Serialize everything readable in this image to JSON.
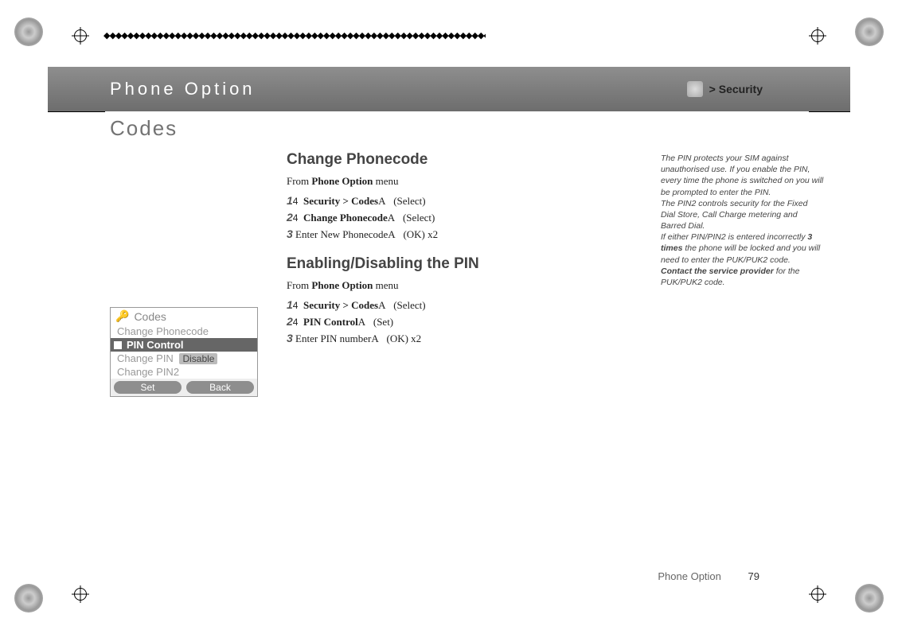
{
  "header": {
    "title": "Phone Option",
    "breadcrumb": "> Security"
  },
  "page_title": "Codes",
  "sections": [
    {
      "heading": "Change Phonecode",
      "from_prefix": "From ",
      "from_bold": "Phone Option",
      "from_suffix": " menu",
      "steps": [
        {
          "num": "1",
          "arrow": "4",
          "bold": "Security > Codes",
          "tail": "A",
          "suffix": "(Select)"
        },
        {
          "num": "2",
          "arrow": "4",
          "bold": "Change Phonecode",
          "tail": "A",
          "suffix": "(Select)"
        },
        {
          "num": "3",
          "arrow": "",
          "plain": "Enter New Phonecode",
          "tail": "A",
          "suffix": "(OK) x2"
        }
      ]
    },
    {
      "heading": "Enabling/Disabling the PIN",
      "from_prefix": "From ",
      "from_bold": "Phone Option",
      "from_suffix": " menu",
      "steps": [
        {
          "num": "1",
          "arrow": "4",
          "bold": "Security > Codes",
          "tail": "A",
          "suffix": "(Select)"
        },
        {
          "num": "2",
          "arrow": "4",
          "bold": "PIN Control",
          "tail": "A",
          "suffix": "(Set)"
        },
        {
          "num": "3",
          "arrow": "",
          "plain": "Enter PIN number",
          "tail": "A",
          "suffix": "(OK) x2"
        }
      ]
    }
  ],
  "sidebar": {
    "p1": "The PIN protects your SIM against unauthorised use. If you enable the PIN, every time the phone is switched on you will be prompted to enter the PIN.",
    "p2": "The PIN2 controls security for the Fixed Dial Store, Call Charge metering and Barred Dial.",
    "p3a": "If either PIN/PIN2 is entered incorrectly ",
    "p3b": "3 times",
    "p3c": " the phone will be locked and you will need to enter the PUK/PUK2 code.",
    "p4a": "Contact the service provider",
    "p4b": " for the PUK/PUK2 code."
  },
  "phone_screen": {
    "title": "Codes",
    "items": {
      "i0": "Change Phonecode",
      "i1": "PIN Control",
      "i2": "Change PIN",
      "i2_badge": "Disable",
      "i3": "Change PIN2"
    },
    "soft_left": "Set",
    "soft_right": "Back"
  },
  "footer": {
    "label": "Phone Option",
    "page": "79"
  },
  "decor": {
    "diamonds": "◆◆◆◆◆◆◆◆◆◆◆◆◆◆◆◆◆◆◆◆◆◆◆◆◆◆◆◆◆◆◆◆◆◆◆◆◆◆◆◆◆◆◆◆◆◆◆◆◆◆◆◆◆◆◆◆◆◆◆◆◆◆◆◆◆◆◆◆◆◆◆◆◆◆◆"
  }
}
